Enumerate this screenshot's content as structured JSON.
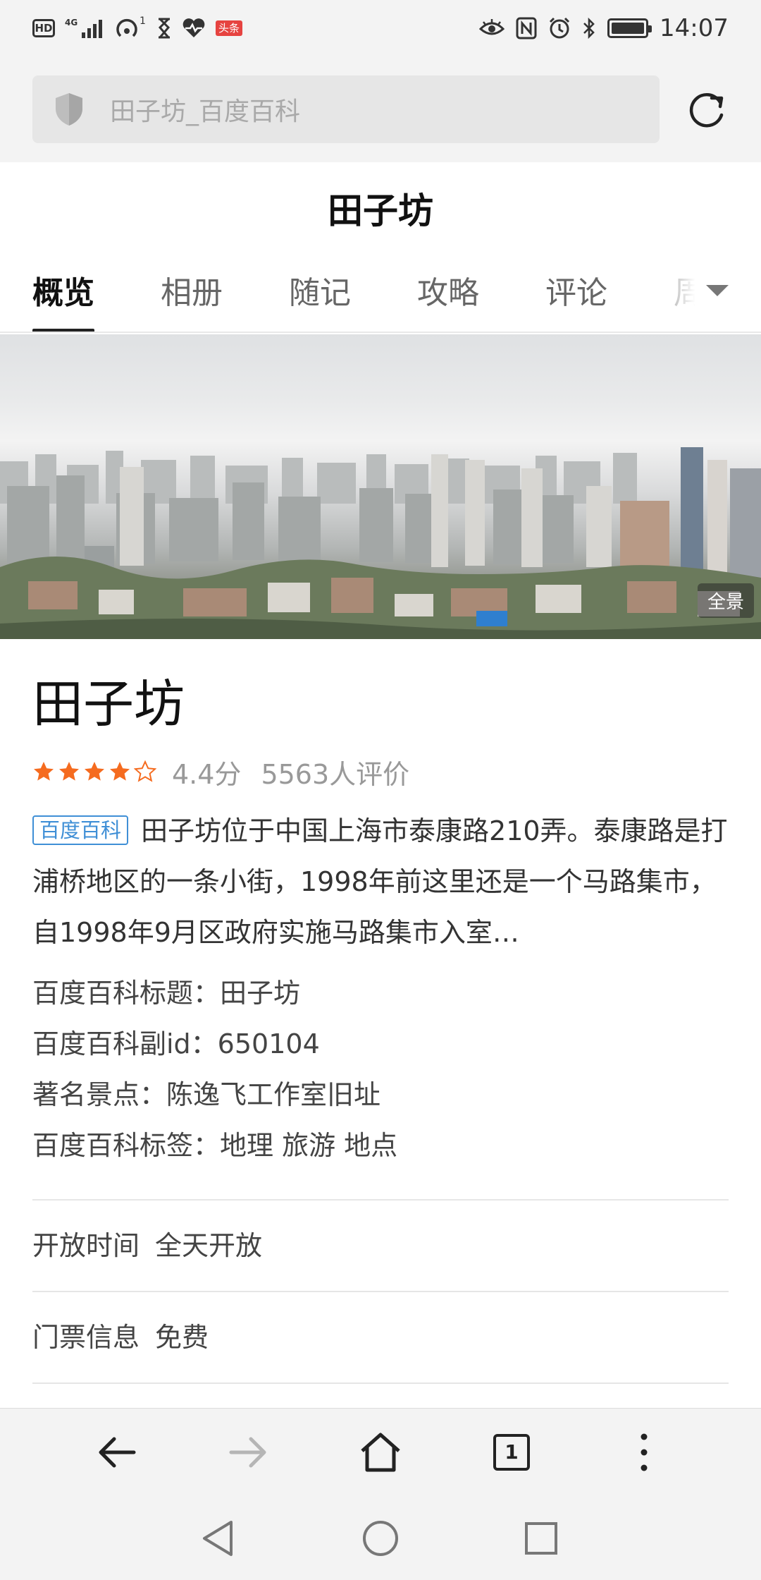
{
  "status_bar": {
    "hd": "HD",
    "network": "4G",
    "hotspot_count": "1",
    "news_badge": "头条",
    "time": "14:07",
    "icons": [
      "signal-icon",
      "hotspot-icon",
      "hourglass-icon",
      "health-icon",
      "eye-icon",
      "nfc-icon",
      "alarm-icon",
      "bluetooth-icon",
      "battery-icon"
    ]
  },
  "address_bar": {
    "url_text": "田子坊_百度百科",
    "icons": [
      "shield-icon",
      "refresh-icon"
    ]
  },
  "page": {
    "title": "田子坊"
  },
  "tabs": [
    {
      "label": "概览",
      "active": true
    },
    {
      "label": "相册",
      "active": false
    },
    {
      "label": "随记",
      "active": false
    },
    {
      "label": "攻略",
      "active": false
    },
    {
      "label": "评论",
      "active": false
    },
    {
      "label": "周边",
      "active": false
    }
  ],
  "hero": {
    "badge": "全景"
  },
  "place": {
    "name": "田子坊",
    "rating_stars": 4.4,
    "score": "4.4分",
    "reviews": "5563人评价",
    "source_tag": "百度百科",
    "description": "田子坊位于中国上海市泰康路210弄。泰康路是打浦桥地区的一条小街，1998年前这里还是一个马路集市，自1998年9月区政府实施马路集市入室…",
    "info": [
      "百度百科标题：田子坊",
      "百度百科副id：650104",
      "著名景点：陈逸飞工作室旧址",
      "百度百科标签：地理   旅游   地点"
    ],
    "opening_label": "开放时间",
    "opening_value": "全天开放",
    "ticket_label": "门票信息",
    "ticket_value": "免费"
  },
  "browser_bar": {
    "tab_count": "1",
    "icons": [
      "back-arrow-icon",
      "forward-arrow-icon",
      "home-icon",
      "tabs-icon",
      "more-vertical-icon"
    ]
  },
  "nav_bar": {
    "icons": [
      "nav-back-triangle-icon",
      "nav-home-circle-icon",
      "nav-recent-square-icon"
    ]
  },
  "colors": {
    "star": "#f56b1f",
    "source_tag": "#3f8fd6",
    "bars": "#f3f3f3"
  }
}
